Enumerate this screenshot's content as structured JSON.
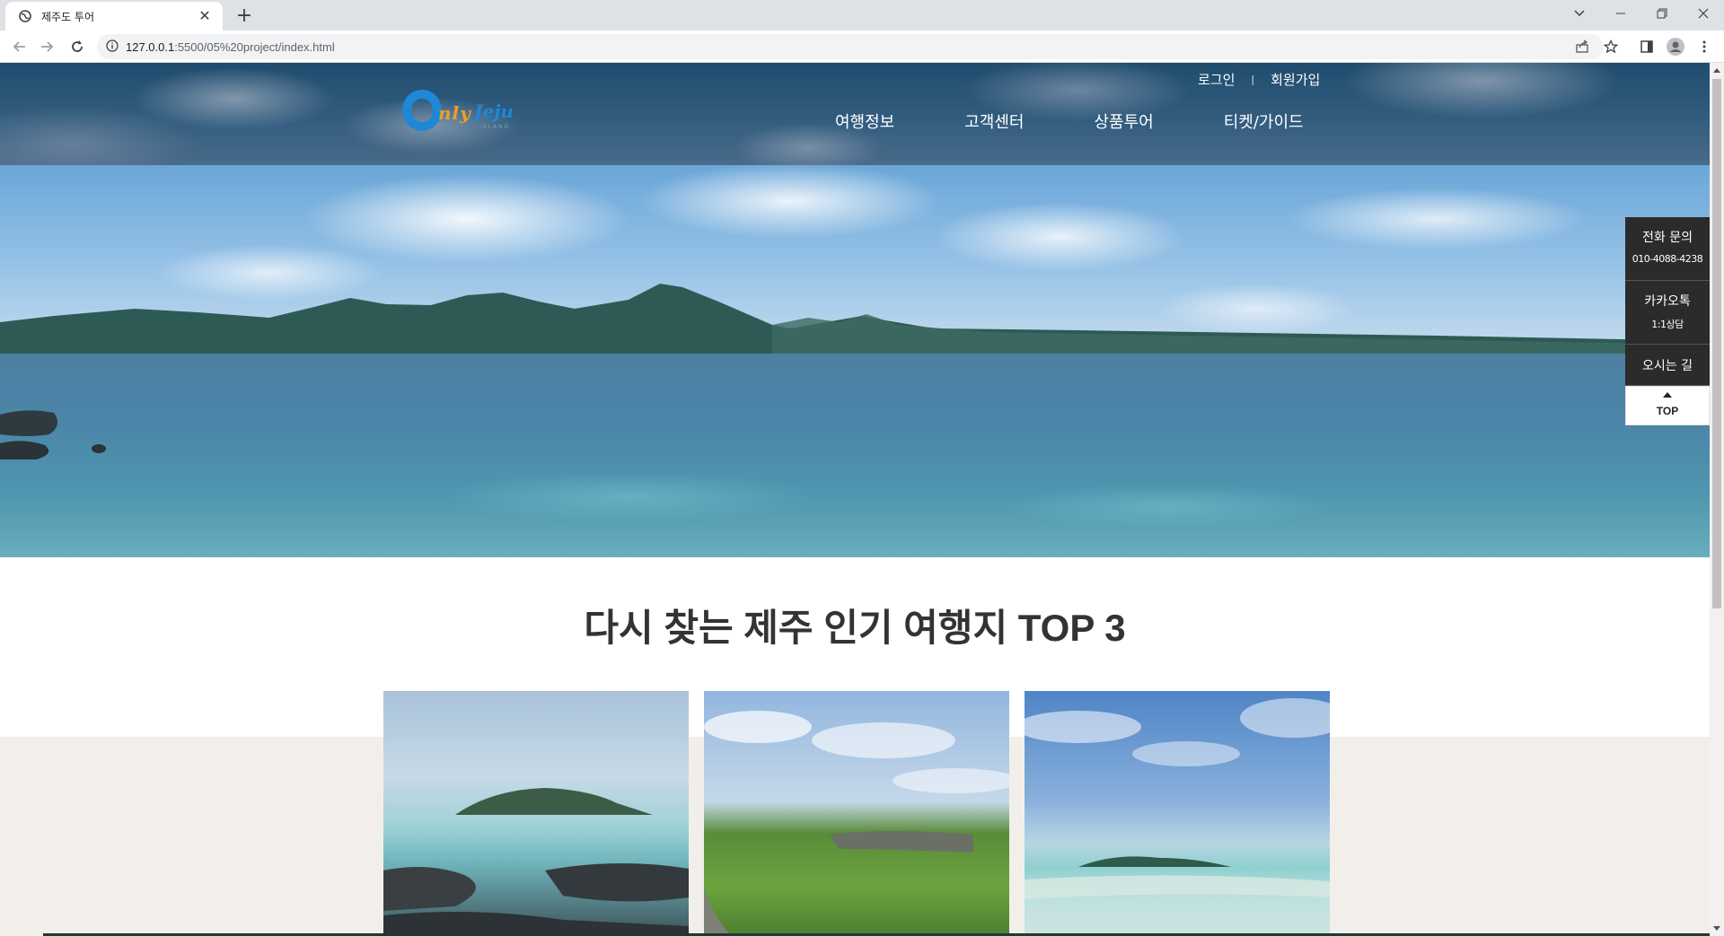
{
  "browser": {
    "tab_title": "제주도 투어",
    "url_host": "127.0.0.1",
    "url_rest": ":5500/05%20project/index.html"
  },
  "header": {
    "logo_alt": "Only Jeju",
    "util_links": [
      "로그인",
      "회원가입"
    ],
    "nav": [
      "여행정보",
      "고객센터",
      "상품투어",
      "티켓/가이드"
    ]
  },
  "hero": {
    "slide_count": 3,
    "active_slide": 3
  },
  "quick_menu": {
    "phone_title": "전화 문의",
    "phone_number": "010-4088-4238",
    "kakao_title": "카카오톡",
    "kakao_sub": "1:1상담",
    "directions": "오시는 길",
    "top": "TOP"
  },
  "section": {
    "title_regular": "다시 찾는 제주 인기 여행지 ",
    "title_bold": "TOP 3"
  },
  "colors": {
    "header_bg": "#1f4c6e",
    "quick_menu_bg": "#2b2b2b",
    "section_band": "#f2efea",
    "title_text": "#333333"
  }
}
